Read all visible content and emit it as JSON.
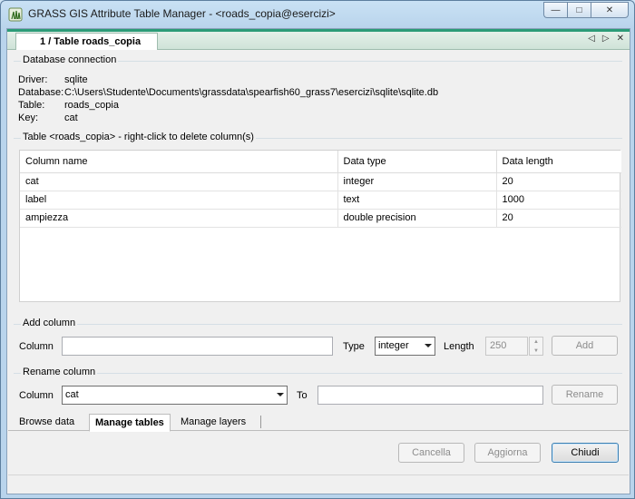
{
  "window": {
    "title": "GRASS GIS Attribute Table Manager - <roads_copia@esercizi>",
    "controls": {
      "minimize": "—",
      "maximize": "□",
      "close": "✕"
    }
  },
  "notebook": {
    "page_tab": "1 / Table roads_copia",
    "nav": {
      "prev": "◁",
      "next": "▷",
      "close": "✕"
    }
  },
  "db_connection": {
    "group_label": "Database connection",
    "driver_label": "Driver:",
    "driver": "sqlite",
    "database_label": "Database:",
    "database": "C:\\Users\\Studente\\Documents\\grassdata\\spearfish60_grass7\\esercizi\\sqlite\\sqlite.db",
    "table_label": "Table:",
    "table": "roads_copia",
    "key_label": "Key:",
    "key": "cat"
  },
  "table_group": {
    "label": "Table <roads_copia> - right-click to delete column(s)",
    "headers": [
      "Column name",
      "Data type",
      "Data length"
    ],
    "rows": [
      [
        "cat",
        "integer",
        "20"
      ],
      [
        "label",
        "text",
        "1000"
      ],
      [
        "ampiezza",
        "double precision",
        "20"
      ]
    ]
  },
  "add_column": {
    "group_label": "Add column",
    "column_label": "Column",
    "column_value": "",
    "type_label": "Type",
    "type_value": "integer",
    "length_label": "Length",
    "length_value": "250",
    "add_button": "Add"
  },
  "rename_column": {
    "group_label": "Rename column",
    "column_label": "Column",
    "column_value": "cat",
    "to_label": "To",
    "to_value": "",
    "rename_button": "Rename"
  },
  "bottom_tabs": [
    "Browse data",
    "Manage tables",
    "Manage layers"
  ],
  "footer": {
    "cancel": "Cancella",
    "apply": "Aggiorna",
    "close": "Chiudi"
  }
}
